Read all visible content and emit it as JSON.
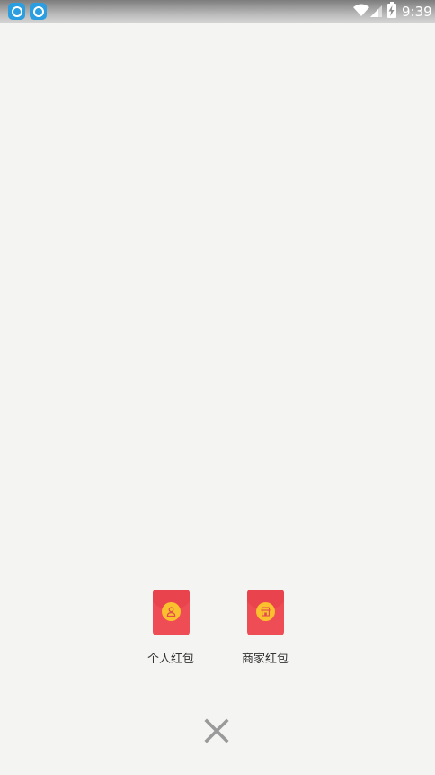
{
  "status_bar": {
    "time": "9:39",
    "notification_icons": [
      "app-notification-icon",
      "app-notification-icon"
    ],
    "indicators": [
      "wifi-icon",
      "signal-icon",
      "battery-charging-icon"
    ]
  },
  "options": [
    {
      "label": "个人红包",
      "icon": "personal-red-envelope-icon"
    },
    {
      "label": "商家红包",
      "icon": "merchant-red-envelope-icon"
    }
  ],
  "close": {
    "icon": "close-icon"
  },
  "colors": {
    "background": "#f4f5f3",
    "envelope_red": "#ef4d55",
    "medal_yellow": "#fbc02d",
    "close_gray": "#9a9a9a"
  }
}
